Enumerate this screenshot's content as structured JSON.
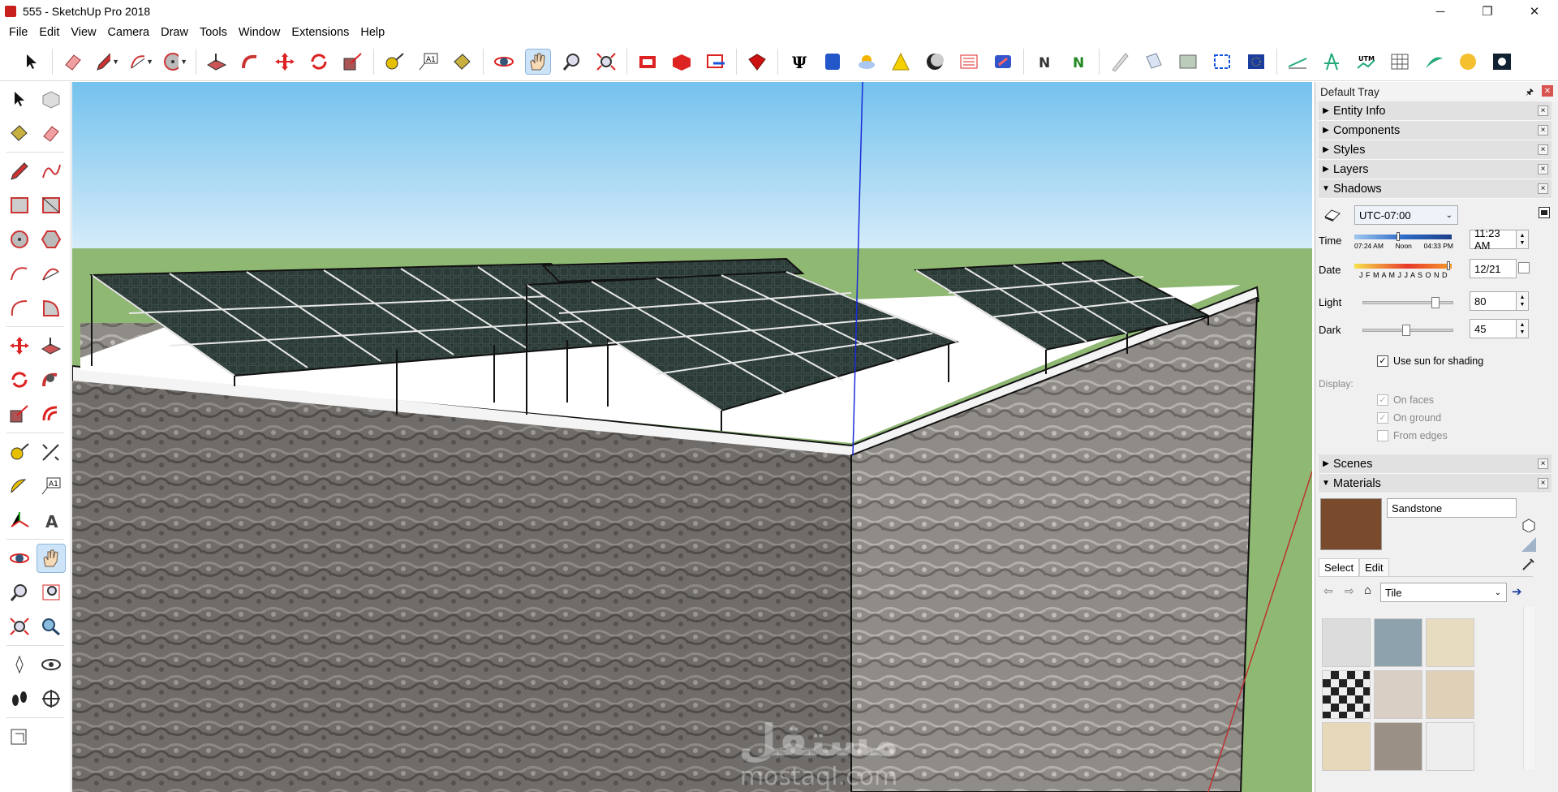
{
  "window": {
    "title": "555 - SketchUp Pro 2018",
    "minimize": "─",
    "restore": "❐",
    "close": "✕"
  },
  "menu": [
    "File",
    "Edit",
    "View",
    "Camera",
    "Draw",
    "Tools",
    "Window",
    "Extensions",
    "Help"
  ],
  "toolbar_icons": [
    "select-icon",
    "eraser-icon",
    "pencil-icon",
    "arc-icon",
    "circle-icon",
    "pushpull-icon",
    "followme-icon",
    "move-icon",
    "rotate-icon",
    "scale-icon",
    "tape-icon",
    "text-icon",
    "paint-icon",
    "orbit-icon",
    "pan-icon",
    "zoom-icon",
    "zoom-extents-icon",
    "warehouse-icon",
    "extension-icon",
    "layout-icon",
    "ruby-icon",
    "fork-icon",
    "cube-icon",
    "sun-icon",
    "cone-icon",
    "moon-icon",
    "section-icon",
    "tag-icon",
    "n-icon",
    "x-icon",
    "ruler-icon",
    "book-icon",
    "photo-icon",
    "box-icon",
    "eu-icon",
    "slope-icon",
    "compass-icon",
    "utm-icon",
    "grid-icon",
    "plant-icon",
    "globe-icon",
    "star-icon"
  ],
  "tray": {
    "title": "Default Tray",
    "panels": {
      "entity_info": "Entity Info",
      "components": "Components",
      "styles": "Styles",
      "layers": "Layers",
      "shadows": "Shadows",
      "scenes": "Scenes",
      "materials": "Materials"
    },
    "shadows": {
      "timezone": "UTC-07:00",
      "time_label": "Time",
      "time_marks": [
        "07:24 AM",
        "Noon",
        "04:33 PM"
      ],
      "time_value": "11:23 AM",
      "date_label": "Date",
      "months": "J F M A M J J A S O N D",
      "date_value": "12/21",
      "light_label": "Light",
      "light_value": "80",
      "dark_label": "Dark",
      "dark_value": "45",
      "use_sun": "Use sun for shading",
      "display_label": "Display:",
      "on_faces": "On faces",
      "on_ground": "On ground",
      "from_edges": "From edges"
    },
    "materials": {
      "name": "Sandstone",
      "tab_select": "Select",
      "tab_edit": "Edit",
      "library": "Tile"
    }
  },
  "watermark": {
    "arabic": "مستقل",
    "latin": "mostaql.com"
  }
}
